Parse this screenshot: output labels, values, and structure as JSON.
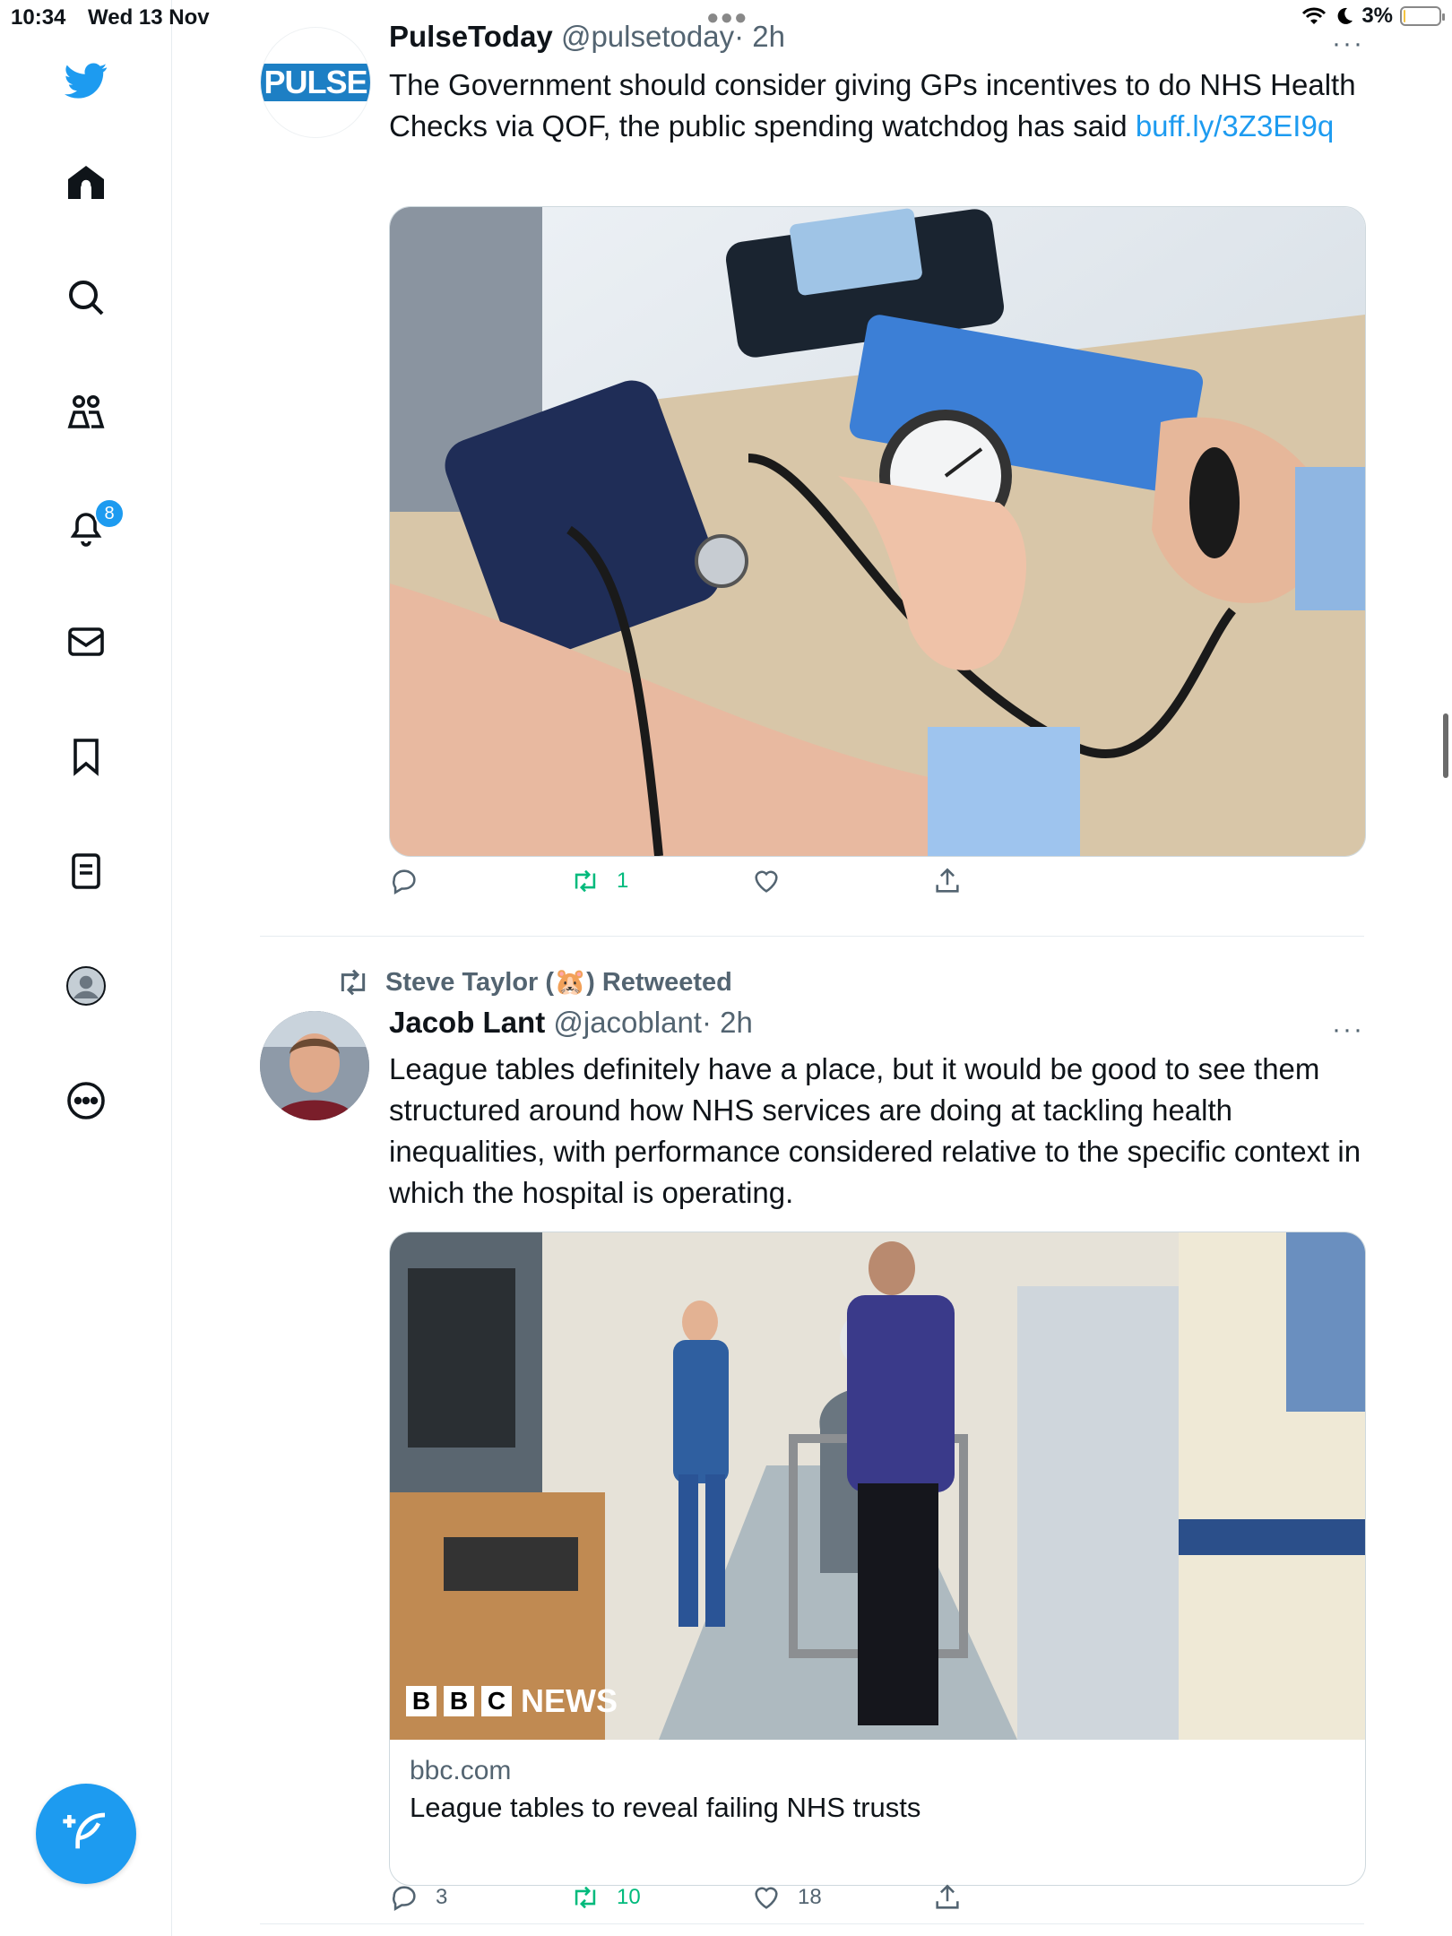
{
  "status_bar": {
    "time": "10:34",
    "date": "Wed 13 Nov",
    "battery": "3%",
    "battery_level": 0.03
  },
  "sidebar": {
    "items": [
      {
        "icon": "twitter-logo-icon"
      },
      {
        "icon": "home-icon"
      },
      {
        "icon": "search-icon"
      },
      {
        "icon": "communities-icon"
      },
      {
        "icon": "notifications-icon",
        "badge": "8"
      },
      {
        "icon": "messages-icon"
      },
      {
        "icon": "bookmarks-icon"
      },
      {
        "icon": "lists-icon"
      },
      {
        "icon": "profile-icon"
      },
      {
        "icon": "more-icon"
      }
    ],
    "compose_icon": "compose-icon"
  },
  "colors": {
    "accent": "#1d9bf0",
    "retweet": "#00ba7c",
    "text": "#0f1419",
    "muted": "#536471"
  },
  "tweets": [
    {
      "name": "PulseToday",
      "handle": "@pulsetoday",
      "time": "· 2h",
      "avatar_text": "PULSE",
      "text": "The Government should consider giving GPs incentives to do NHS Health Checks via QOF, the public spending watchdog has said ",
      "link": "buff.ly/3Z3EI9q",
      "actions": {
        "replies": "",
        "retweets": "1",
        "likes": ""
      }
    },
    {
      "retweeted_by": "Steve Taylor (🐹) Retweeted",
      "name": "Jacob Lant",
      "handle": "@jacoblant",
      "time": "· 2h",
      "text": "League tables definitely have a place, but it would be good to see them structured around how NHS services are doing at tackling health inequalities, with performance considered relative to the specific context in which the hospital is operating.",
      "card": {
        "logo": [
          "B",
          "B",
          "C"
        ],
        "logo_word": "NEWS",
        "domain": "bbc.com",
        "title": "League tables to reveal failing NHS trusts"
      },
      "actions": {
        "replies": "3",
        "retweets": "10",
        "likes": "18"
      }
    }
  ]
}
